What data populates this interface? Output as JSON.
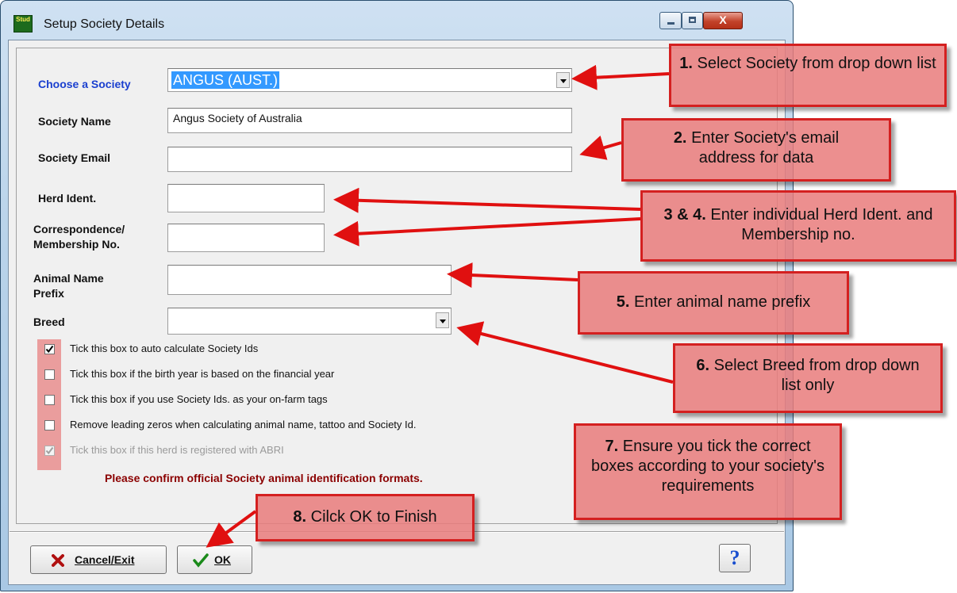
{
  "window": {
    "title": "Setup Society Details",
    "logo_text": "Stud"
  },
  "form": {
    "choose_society_label": "Choose a Society",
    "choose_society_value": "ANGUS (AUST.)",
    "society_name_label": "Society Name",
    "society_name_value": "Angus Society of Australia",
    "society_email_label": "Society Email",
    "society_email_value": "",
    "herd_ident_label": "Herd Ident.",
    "herd_ident_value": "",
    "correspondence_label_line1": "Correspondence/",
    "correspondence_label_line2": "Membership No.",
    "correspondence_value": "",
    "animal_prefix_label_line1": "Animal Name",
    "animal_prefix_label_line2": "Prefix",
    "animal_prefix_value": "",
    "breed_label": "Breed",
    "breed_value": ""
  },
  "checkboxes": [
    {
      "label": "Tick this box to auto calculate Society Ids",
      "checked": true,
      "enabled": true
    },
    {
      "label": "Tick this box if the birth year is based on the financial year",
      "checked": false,
      "enabled": true
    },
    {
      "label": "Tick this box if you use Society Ids. as your on-farm tags",
      "checked": false,
      "enabled": true
    },
    {
      "label": "Remove leading zeros when calculating animal name, tattoo and Society Id.",
      "checked": false,
      "enabled": true
    },
    {
      "label": "Tick this box if this herd is registered with ABRI",
      "checked": true,
      "enabled": false
    }
  ],
  "confirm_note": "Please confirm official Society animal identification formats.",
  "buttons": {
    "cancel_label": "Cancel/Exit",
    "ok_label": "OK",
    "help_label": "?"
  },
  "callouts": {
    "c1_num": "1.",
    "c1_text": "Select Society from drop down list",
    "c2_num": "2.",
    "c2_text": "Enter Society's email address for data",
    "c3_num": "3 & 4.",
    "c3_text": "Enter individual Herd Ident. and Membership no.",
    "c5_num": "5.",
    "c5_text": "Enter animal name prefix",
    "c6_num": "6.",
    "c6_text": "Select Breed from drop down list only",
    "c7_num": "7.",
    "c7_text": "Ensure you tick the correct boxes according to your society's requirements",
    "c8_num": "8.",
    "c8_text": "Cilck OK to Finish"
  },
  "colors": {
    "callout_fill": "#e97b7b",
    "callout_border": "#d42020",
    "arrow": "#e01010",
    "choose_label": "#1a3fcf",
    "note": "#8b0000",
    "selection": "#3399ff"
  },
  "icons": {
    "cancel": "x-icon",
    "ok": "checkmark-icon",
    "help": "question-icon"
  }
}
